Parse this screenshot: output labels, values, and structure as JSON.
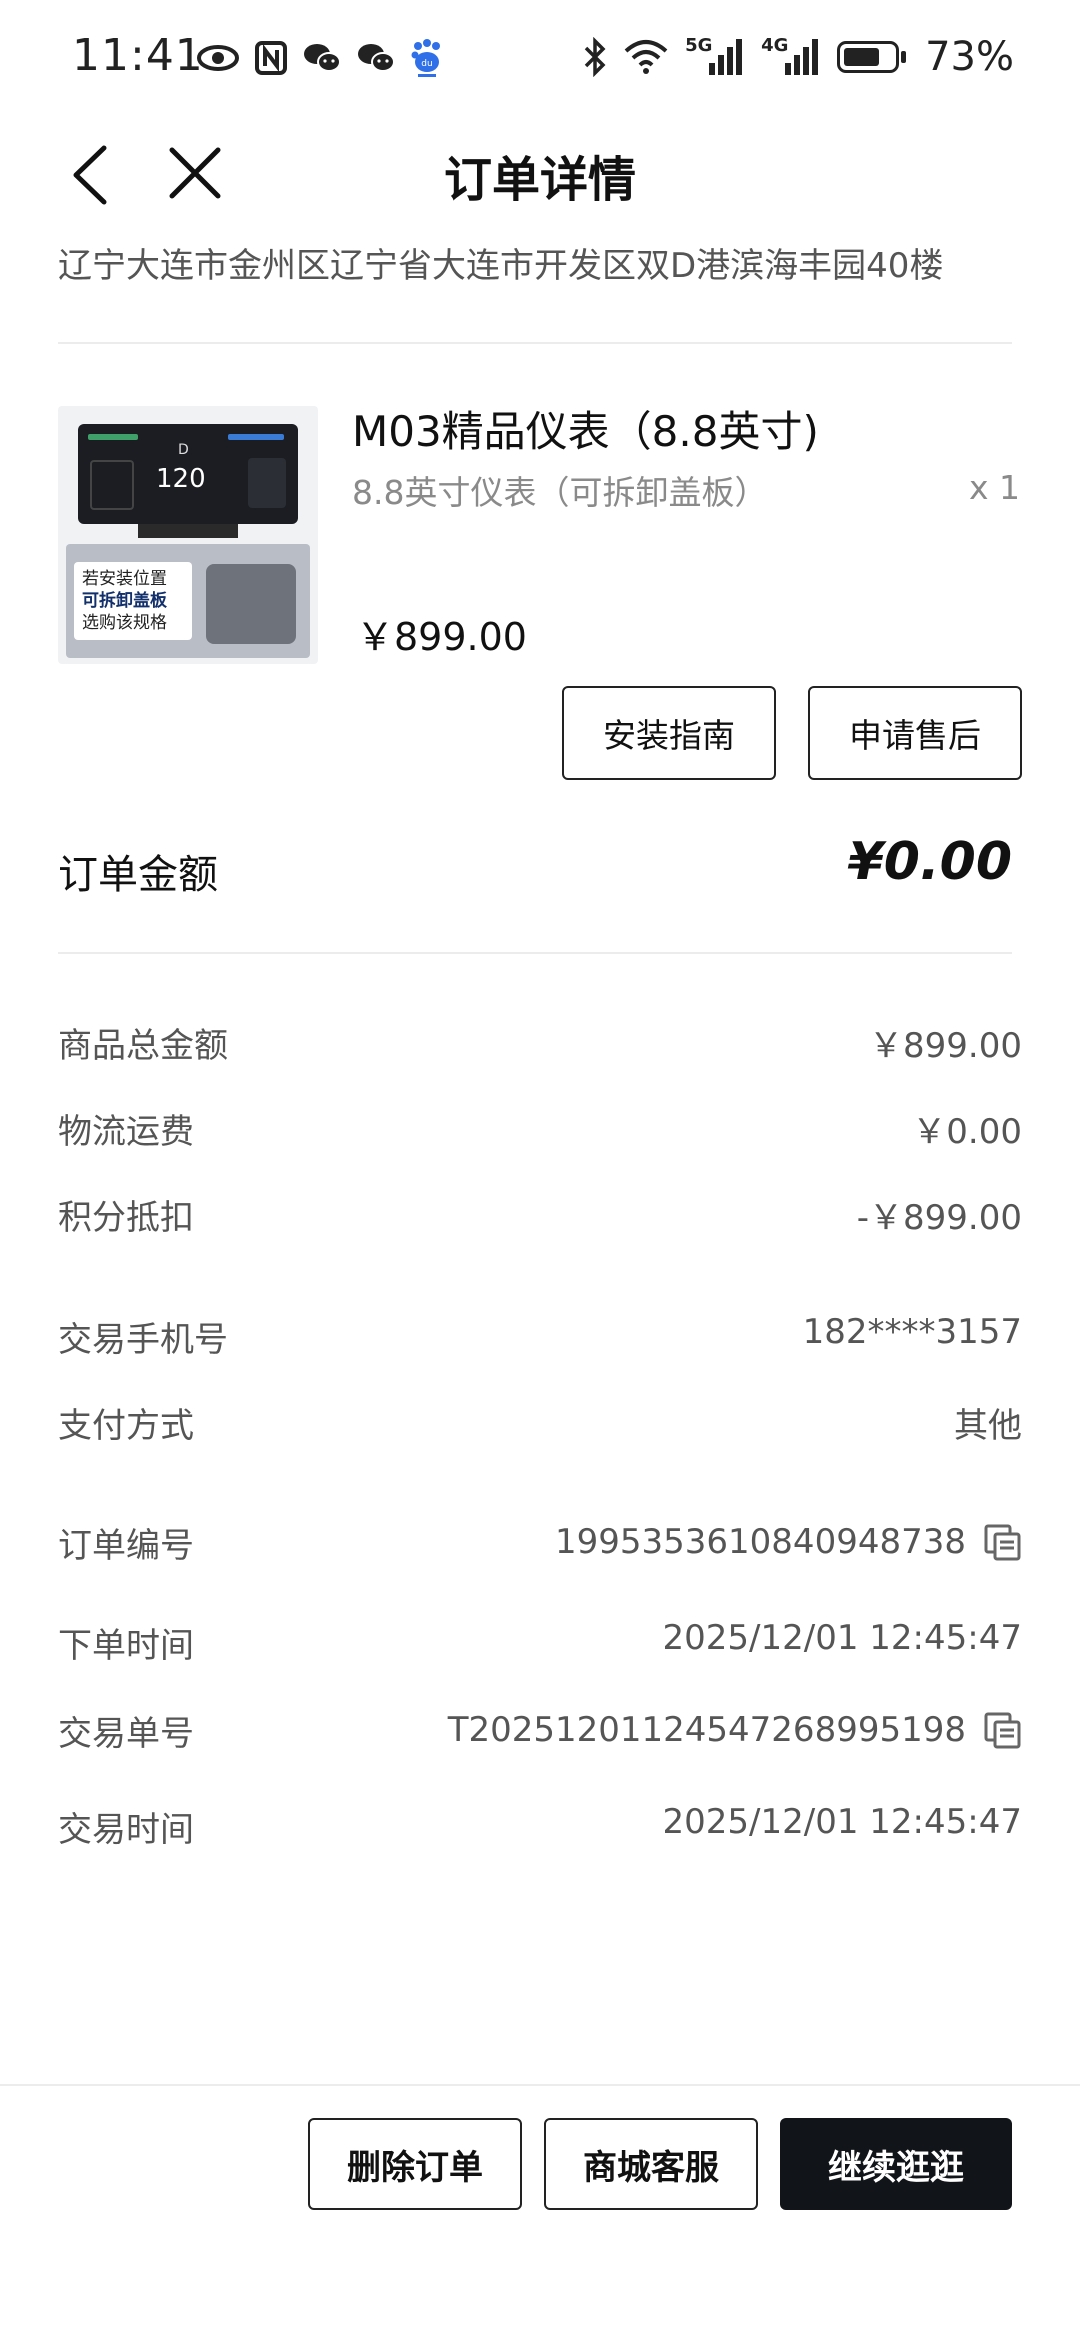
{
  "status_bar": {
    "time": "11:41",
    "left_icons": [
      "eye-icon",
      "nfc-icon",
      "wechat-icon",
      "wechat-icon",
      "baidu-icon"
    ],
    "right_icons": [
      "bluetooth-icon",
      "wifi-icon",
      "signal-5g-icon",
      "signal-4g-icon",
      "battery-icon"
    ],
    "network_5g": "5G",
    "network_4g": "4G",
    "battery": "73%",
    "battery_level": 0.73
  },
  "header": {
    "title": "订单详情"
  },
  "address": "辽宁大连市金州区辽宁省大连市开发区双D港滨海丰园40楼",
  "product": {
    "name": "M03精品仪表（8.8英寸)",
    "spec": "8.8英寸仪表（可拆卸盖板）",
    "qty": "x 1",
    "price": "￥899.00",
    "image": {
      "speed": "120",
      "gear": "D",
      "overlay_lines": [
        "若安装位置",
        "可拆卸盖板",
        "选购该规格"
      ]
    }
  },
  "actions": {
    "install_guide": "安装指南",
    "after_sale": "申请售后"
  },
  "order_total": {
    "label": "订单金额",
    "value": "¥0.00"
  },
  "amount_rows": [
    {
      "label": "商品总金额",
      "value": "￥899.00"
    },
    {
      "label": "物流运费",
      "value": "￥0.00"
    },
    {
      "label": "积分抵扣",
      "value": "-￥899.00"
    }
  ],
  "contact_rows": [
    {
      "label": "交易手机号",
      "value": "182****3157"
    },
    {
      "label": "支付方式",
      "value": "其他"
    }
  ],
  "order_rows": [
    {
      "label": "订单编号",
      "value": "1995353610840948738",
      "copyable": true
    },
    {
      "label": "下单时间",
      "value": "2025/12/01 12:45:47",
      "copyable": false
    },
    {
      "label": "交易单号",
      "value": "T2025120112454726899519​8",
      "copyable": true
    },
    {
      "label": "交易时间",
      "value": "2025/12/01 12:45:47",
      "copyable": false
    }
  ],
  "bottom_bar": {
    "delete_order": "删除订单",
    "customer_service": "商城客服",
    "continue_shopping": "继续逛逛"
  },
  "colors": {
    "primary_dark": "#111418",
    "text_secondary": "#555555",
    "text_muted": "#8a8a8a",
    "divider": "#ececec"
  }
}
